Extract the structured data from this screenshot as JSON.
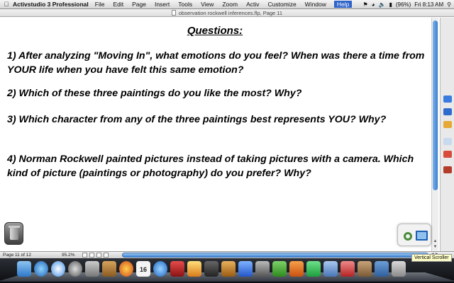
{
  "menubar": {
    "app_name": "Activstudio 3 Professional",
    "items": [
      "File",
      "Edit",
      "Page",
      "Insert",
      "Tools",
      "View",
      "Zoom",
      "Activ",
      "Customize",
      "Window",
      "Help"
    ],
    "active_item": "Help",
    "battery": "(96%)",
    "clock": "Fri 8:13 AM"
  },
  "window": {
    "title": "observation rockwell inferences.flp, Page 11"
  },
  "flipchart": {
    "heading": "Questions:",
    "questions": [
      "1)  After analyzing \"Moving In\", what emotions do you feel?  When was there a time from YOUR life when you have felt this same emotion?",
      "2)  Which of these three paintings do you like the most?  Why?",
      "3)  Which character from any of the three paintings best represents YOU? Why?",
      "4)  Norman Rockwell painted pictures instead of taking pictures with a camera.  Which kind of picture (paintings or photography) do you prefer? Why?"
    ]
  },
  "statusbar": {
    "page_label": "Page",
    "current_page": "11",
    "of_label": "of",
    "total_pages": "12",
    "zoom": "95.2%"
  },
  "dock": {
    "calendar_day": "16"
  },
  "tooltip": {
    "text": "Vertical Scroller"
  },
  "colors": {
    "accent": "#2e63c9",
    "scroll_blue": "#3f85d6"
  }
}
